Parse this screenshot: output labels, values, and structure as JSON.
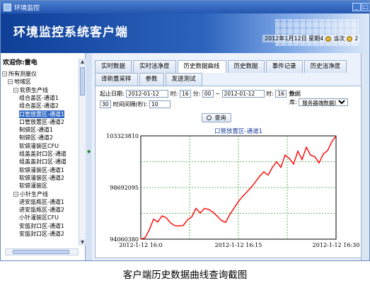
{
  "window": {
    "title": "环境监控"
  },
  "banner": {
    "app_title": "环境监控系统客户端"
  },
  "status": {
    "datetime": "2012年1月12日 星期4",
    "user_label": "当次",
    "extra": "2"
  },
  "left": {
    "welcome": "欢迎你:雷电",
    "tree": [
      {
        "label": "所有测量仪",
        "level": 0,
        "exp": "⊟"
      },
      {
        "label": "地域区",
        "level": 1,
        "exp": "⊟"
      },
      {
        "label": "软质生产线",
        "level": 2,
        "exp": "⊟"
      },
      {
        "label": "组合盖区-通道1",
        "level": 3,
        "exp": ""
      },
      {
        "label": "组合盖区-通道2",
        "level": 3,
        "exp": ""
      },
      {
        "label": "口管放置区-通道1",
        "level": 3,
        "exp": "",
        "selected": true
      },
      {
        "label": "口管放置区-通道2",
        "level": 3,
        "exp": ""
      },
      {
        "label": "制袋区-通道1",
        "level": 3,
        "exp": ""
      },
      {
        "label": "制袋区-通道2",
        "level": 3,
        "exp": ""
      },
      {
        "label": "软袋灌装区CFU",
        "level": 3,
        "exp": ""
      },
      {
        "label": "组盖盖封口区-通道",
        "level": 3,
        "exp": ""
      },
      {
        "label": "组盖盖封口区-通道",
        "level": 3,
        "exp": ""
      },
      {
        "label": "软袋灌装区-通道1",
        "level": 3,
        "exp": ""
      },
      {
        "label": "软袋灌装区-通道2",
        "level": 3,
        "exp": ""
      },
      {
        "label": "软袋灌装区",
        "level": 3,
        "exp": ""
      },
      {
        "label": "小针生产线",
        "level": 2,
        "exp": "⊟"
      },
      {
        "label": "进安瓿瓶区-通道1",
        "level": 3,
        "exp": ""
      },
      {
        "label": "进安瓿瓶区-通道2",
        "level": 3,
        "exp": ""
      },
      {
        "label": "小针灌装区CFU",
        "level": 3,
        "exp": ""
      },
      {
        "label": "安瓿封口区-通道1",
        "level": 3,
        "exp": ""
      },
      {
        "label": "安瓿封口区-通道2",
        "level": 3,
        "exp": ""
      }
    ]
  },
  "tabs_row1": [
    "实时数据",
    "实时洁净度",
    "历史数据曲线",
    "历史数据",
    "事件记录",
    "历史洁净度"
  ],
  "tabs_row2": [
    "译新置采样",
    "参数",
    "发送测试"
  ],
  "active_tab": "历史数据曲线",
  "form": {
    "start_date_label": "起止日期:",
    "start_date": "2012-01-12",
    "hour_label": "时:",
    "start_hour": "16",
    "min_label": "分:",
    "start_min": "00",
    "sep": "~",
    "end_date": "2012-01-12",
    "end_hour": "16",
    "end_min_label": "分:",
    "end_min": "30",
    "interval_label": "时间间隔(秒):",
    "interval": "10",
    "db_label": "数据",
    "db_label2": "库:",
    "db_value": "服务器端数据库",
    "query_label": "查询"
  },
  "chart_data": {
    "type": "line",
    "title": "口管放置区-通道1",
    "ylim": [
      94060380,
      103323810
    ],
    "yticks": [
      94060380,
      98692095,
      103323810
    ],
    "xticks": [
      "2012-1-12 16:0",
      "2012-1-12 16:15",
      "2012-1-12 16:30"
    ],
    "series": [
      {
        "color": "#ff0000",
        "values": [
          94010000,
          94180000,
          94900000,
          95850000,
          95600000,
          96150000,
          95980000,
          95520000,
          95270000,
          95250000,
          95290000,
          95800000,
          96050000,
          96820000,
          96400000,
          96820000,
          96730000,
          96490000,
          96120000,
          95730000,
          95570000,
          96290000,
          96860000,
          97440000,
          97890000,
          98300000,
          98700000,
          99200000,
          99700000,
          100100000,
          99800000,
          100500000,
          101000000,
          100500000,
          101600000,
          101300000,
          100800000,
          101950000,
          101200000,
          102300000,
          101600000,
          101450000,
          100900000,
          101700000,
          102000000,
          102800000,
          103323810
        ]
      }
    ]
  },
  "caption": "客户端历史数据曲线查询截图",
  "colors": {
    "line": "#ff0000",
    "plot_grid": "#3aa03a",
    "title_blue": "#1f3fa0"
  }
}
